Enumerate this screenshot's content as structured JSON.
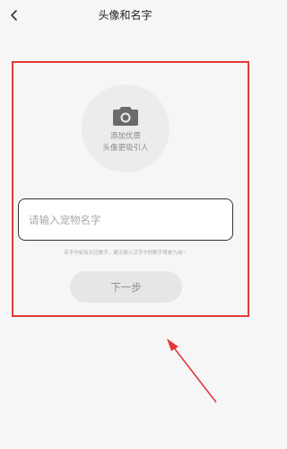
{
  "header": {
    "title": "头像和名字",
    "back_icon": "chevron-left-icon"
  },
  "avatar": {
    "icon": "camera-icon",
    "line1": "添加优质",
    "line2": "头像更吸引人"
  },
  "name_input": {
    "placeholder": "请输入宠物名字",
    "value": ""
  },
  "hint": "名字中如有对应数字，建议输入汉字中的数字哥是九纯~",
  "next_button": {
    "label": "下一步"
  },
  "colors": {
    "background": "#f6f6f6",
    "highlight": "#e23a3a",
    "button_bg": "#e6e6e6",
    "avatar_bg": "#ececec"
  }
}
